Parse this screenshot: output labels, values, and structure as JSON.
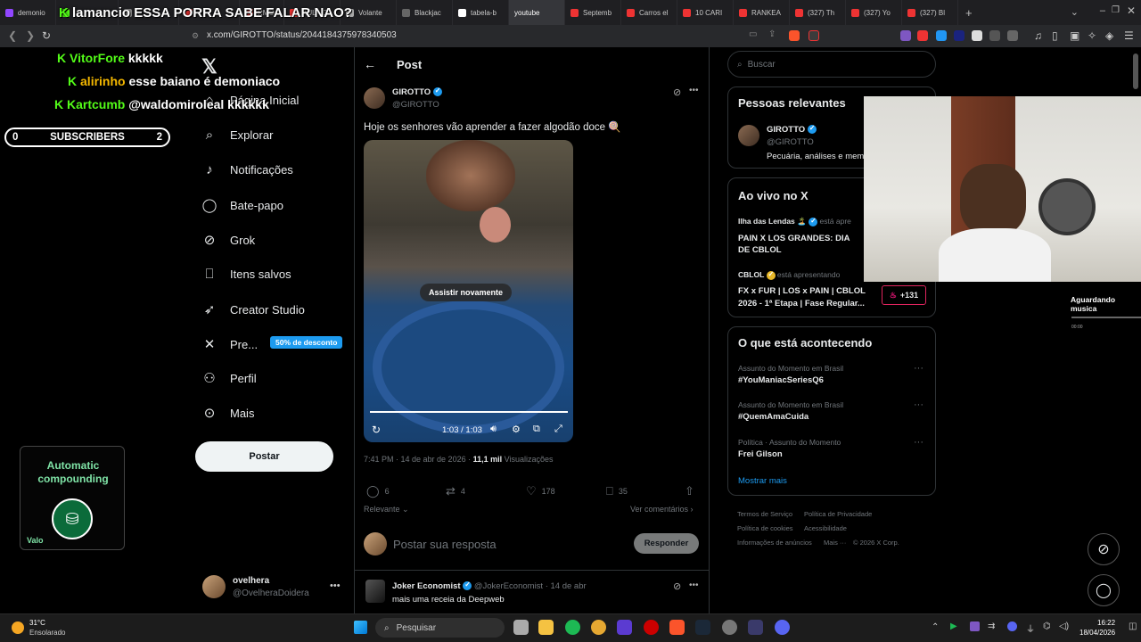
{
  "browser": {
    "tabs": [
      "demonio",
      "",
      "",
      "",
      "",
      "RMO G",
      "AULA DI",
      "Volante",
      "Blackjac",
      "tabela-b",
      "youtube",
      "Septemb",
      "Carros el",
      "10 CARI",
      "RANKEA",
      "(327) Th",
      "(327) Yo",
      "(327) Bl"
    ],
    "active_tab": "youtube",
    "url": "x.com/GIROTTO/status/2044184375978340503"
  },
  "nav": {
    "items": [
      {
        "icon": "home-icon",
        "label": "Página Inicial"
      },
      {
        "icon": "search-icon",
        "label": "Explorar"
      },
      {
        "icon": "bell-icon",
        "label": "Notificações"
      },
      {
        "icon": "chat-icon",
        "label": "Bate-papo"
      },
      {
        "icon": "grok-icon",
        "label": "Grok"
      },
      {
        "icon": "bookmark-icon",
        "label": "Itens salvos"
      },
      {
        "icon": "rocket-icon",
        "label": "Creator Studio"
      },
      {
        "icon": "x-icon",
        "label": "Pre..."
      },
      {
        "icon": "person-icon",
        "label": "Perfil"
      },
      {
        "icon": "more-icon",
        "label": "Mais"
      }
    ],
    "premium_badge": "50% de desconto",
    "post_button": "Postar",
    "account_name": "ovelhera",
    "account_handle": "@OvelheraDoidera"
  },
  "post": {
    "header": "Post",
    "author_name": "GIROTTO",
    "author_handle": "@GIROTTO",
    "text": "Hoje os senhores vão aprender a fazer algodão doce 🍭",
    "video": {
      "replay_label": "Assistir novamente",
      "time": "1:03 / 1:03",
      "progress": 1.0
    },
    "timestamp": "7:41 PM · 14 de abr de 2026 ·",
    "views_count": "11,1 mil",
    "views_label": "Visualizações",
    "stats": {
      "replies": "6",
      "reposts": "4",
      "likes": "178",
      "bookmarks": "35"
    },
    "sort_label": "Relevante",
    "comments_link": "Ver comentários",
    "reply_placeholder": "Postar sua resposta",
    "reply_button": "Responder"
  },
  "reply": {
    "name": "Joker Economist",
    "handle": "@JokerEconomist",
    "date": "· 14 de abr",
    "text": "mais uma receia da Deepweb"
  },
  "sidebar": {
    "search_placeholder": "Buscar",
    "relevant": {
      "title": "Pessoas relevantes",
      "name": "GIROTTO",
      "handle": "@GIROTTO",
      "bio": "Pecuária, análises e mem"
    },
    "live": {
      "title": "Ao vivo no X",
      "items": [
        {
          "host": "Ilha das Lendas 🏝️",
          "status": "está apre",
          "title": "PAIN X LOS GRANDES: DIA DE CBLOL"
        },
        {
          "host": "CBLOL",
          "status": "está apresentando",
          "title": "FX x FUR | LOS x PAIN | CBLOL 2026 - 1ª Etapa | Fase Regular...",
          "count": "+131"
        }
      ]
    },
    "trends": {
      "title": "O que está acontecendo",
      "items": [
        {
          "category": "Assunto do Momento em Brasil",
          "name": "#YouManiacSeriesQ6"
        },
        {
          "category": "Assunto do Momento em Brasil",
          "name": "#QuemAmaCuida"
        },
        {
          "category": "Política · Assunto do Momento",
          "name": "Frei Gilson"
        }
      ],
      "more": "Mostrar mais"
    },
    "footer": [
      "Termos de Serviço",
      "Política de Privacidade",
      "Política de cookies",
      "Acessibilidade",
      "Informações de anúncios",
      "Mais ···",
      "© 2026 X Corp."
    ]
  },
  "stream_overlay": {
    "chat": [
      {
        "user": "lamancio",
        "message": "ESSA PORRA SABE FALAR NAO?"
      },
      {
        "user": "VitorFore",
        "message": "kkkkk"
      },
      {
        "user": "alirinho",
        "message": "esse baiano é demoniaco"
      },
      {
        "user": "Kartcumb",
        "message": "@waldomiroleal kkkkkk"
      }
    ],
    "subscribers": {
      "left": "0",
      "label": "SUBSCRIBERS",
      "right": "2"
    },
    "widget_title": "Automatic compounding",
    "widget_tag": "Valo",
    "music_status": "Aguardando musica",
    "music_time": "00:00"
  },
  "taskbar": {
    "temperature": "31°C",
    "weather": "Ensolarado",
    "search_label": "Pesquisar",
    "time": "16:22",
    "date": "18/04/2026"
  },
  "colors": {
    "accent": "#1d9bf0",
    "kick_green": "#53fc18",
    "background": "#000000"
  }
}
